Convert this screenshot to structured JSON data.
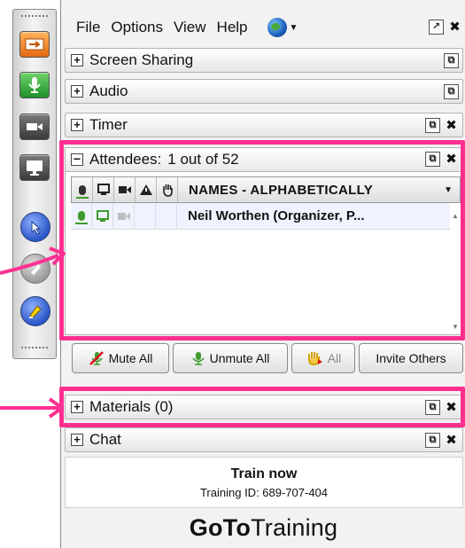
{
  "menubar": {
    "items": [
      "File",
      "Options",
      "View",
      "Help"
    ],
    "globe_icon": "globe-icon"
  },
  "sections": {
    "screen_sharing": "Screen Sharing",
    "audio": "Audio",
    "timer": "Timer",
    "materials": "Materials (0)",
    "chat": "Chat"
  },
  "attendees": {
    "title": "Attendees:",
    "count": "1 out of 52",
    "column_header": "NAMES - ALPHABETICALLY",
    "rows": [
      {
        "name": "Neil Worthen (Organizer, P..."
      }
    ]
  },
  "buttons": {
    "mute_all": "Mute All",
    "unmute_all": "Unmute All",
    "all": "All",
    "invite_others": "Invite Others"
  },
  "training": {
    "title": "Train now",
    "id_label": "Training ID: 689-707-404"
  },
  "brand": {
    "bold": "GoTo",
    "regular": "Training"
  },
  "colors": {
    "highlight": "#ff2f92",
    "mic_green": "#3d9b2d",
    "toolbar_orange": "#f07a1f",
    "toolbar_green": "#2e9a3a",
    "toolbar_blue": "#2a56c6"
  }
}
